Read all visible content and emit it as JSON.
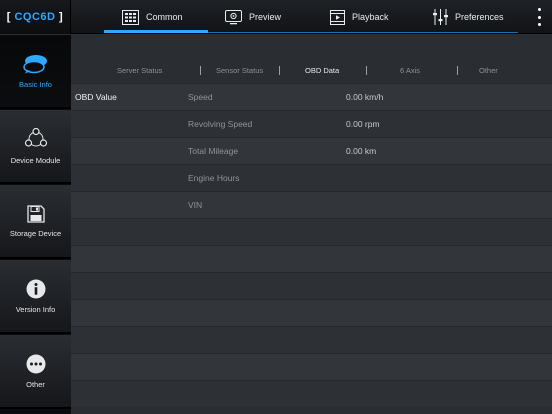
{
  "app": {
    "brand": "CQC6D",
    "accent": "#2fa8ff"
  },
  "top_tabs": [
    {
      "label": "Common",
      "icon": "grid-icon",
      "active": true
    },
    {
      "label": "Preview",
      "icon": "monitor-icon",
      "active": false
    },
    {
      "label": "Playback",
      "icon": "play-icon",
      "active": false
    },
    {
      "label": "Preferences",
      "icon": "sliders-icon",
      "active": false
    }
  ],
  "sidebar": {
    "items": [
      {
        "label": "Basic Info",
        "icon": "chat-bubbles-icon",
        "active": true
      },
      {
        "label": "Device Module",
        "icon": "module-icon",
        "active": false
      },
      {
        "label": "Storage Device",
        "icon": "floppy-icon",
        "active": false
      },
      {
        "label": "Version Info",
        "icon": "info-icon",
        "active": false
      },
      {
        "label": "Other",
        "icon": "ellipsis-icon",
        "active": false
      }
    ]
  },
  "sub_tabs": [
    {
      "label": "Server Status",
      "active": false
    },
    {
      "label": "Sensor Status",
      "active": false
    },
    {
      "label": "OBD Data",
      "active": true
    },
    {
      "label": "6 Axis",
      "active": false
    },
    {
      "label": "Other",
      "active": false
    }
  ],
  "obd": {
    "section_label": "OBD Value",
    "rows": [
      {
        "label": "Speed",
        "value": "0.00 km/h"
      },
      {
        "label": "Revolving Speed",
        "value": "0.00 rpm"
      },
      {
        "label": "Total Mileage",
        "value": "0.00 km"
      },
      {
        "label": "Engine Hours",
        "value": ""
      },
      {
        "label": "VIN",
        "value": ""
      }
    ]
  }
}
